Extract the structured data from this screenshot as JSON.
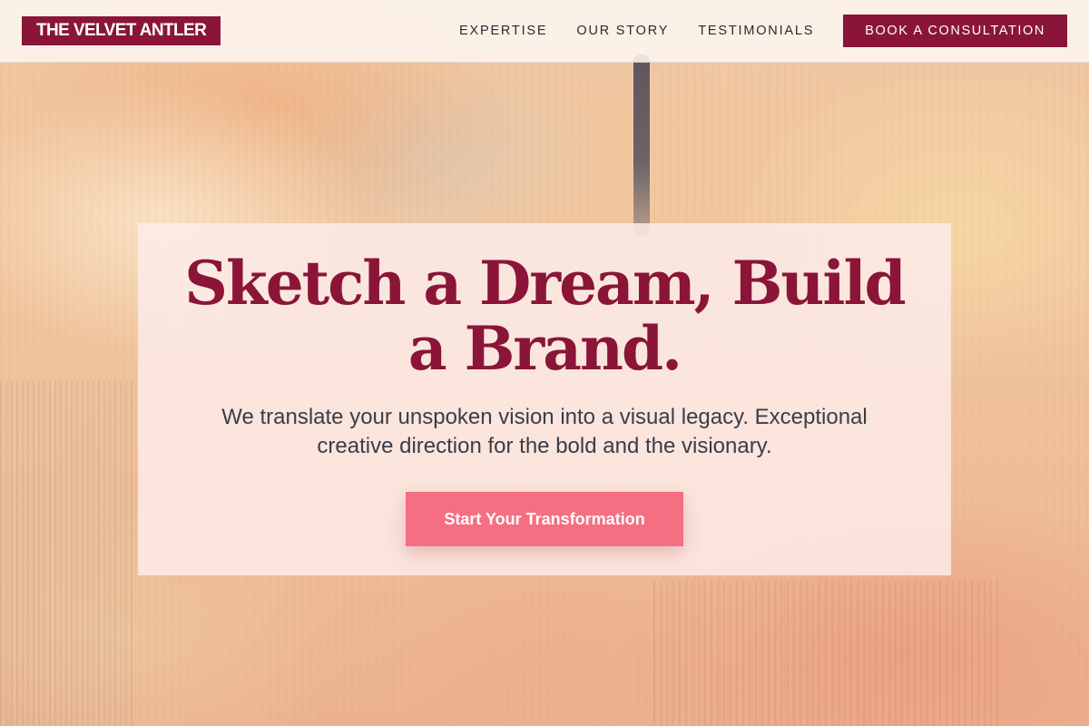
{
  "brand": {
    "name": "THE VELVET ANTLER"
  },
  "nav": {
    "links": [
      {
        "label": "EXPERTISE"
      },
      {
        "label": "OUR STORY"
      },
      {
        "label": "TESTIMONIALS"
      }
    ],
    "cta_label": "BOOK A CONSULTATION"
  },
  "hero": {
    "title": "Sketch a Dream, Build a Brand.",
    "subtitle": "We translate your unspoken vision into a visual legacy. Exceptional creative direction for the bold and the visionary.",
    "button_label": "Start Your Transformation"
  },
  "colors": {
    "brand_primary": "#8a1538",
    "accent_button": "#f66e82",
    "body_text": "#3a3d48",
    "nav_text": "#2a2a30"
  }
}
